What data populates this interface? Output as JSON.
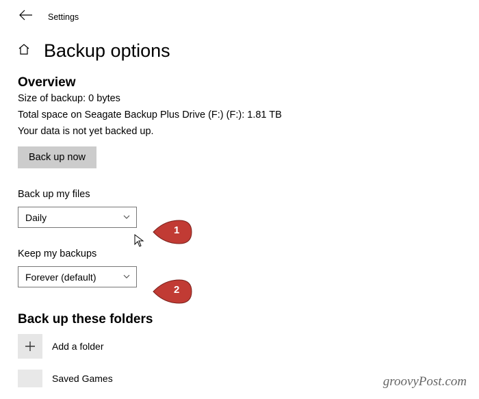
{
  "header": {
    "app_label": "Settings"
  },
  "page": {
    "title": "Backup options"
  },
  "overview": {
    "heading": "Overview",
    "size_line": "Size of backup: 0 bytes",
    "space_line": "Total space on Seagate Backup Plus Drive (F:) (F:): 1.81 TB",
    "status_line": "Your data is not yet backed up.",
    "backup_now_label": "Back up now"
  },
  "frequency": {
    "label": "Back up my files",
    "value": "Daily"
  },
  "retention": {
    "label": "Keep my backups",
    "value": "Forever (default)"
  },
  "folders": {
    "heading": "Back up these folders",
    "add_label": "Add a folder",
    "item_0": "Saved Games"
  },
  "callouts": {
    "one": "1",
    "two": "2"
  },
  "watermark": "groovyPost.com"
}
